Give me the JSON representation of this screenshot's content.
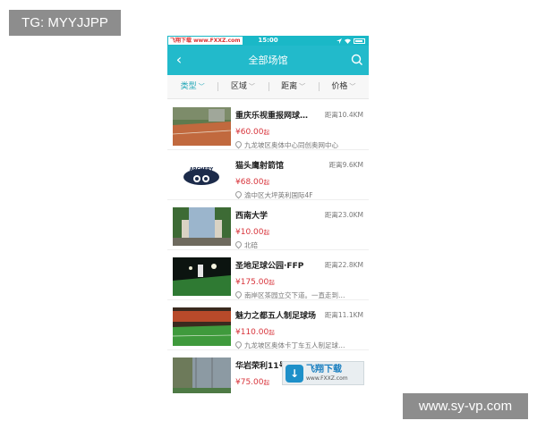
{
  "overlay": {
    "tg_label": "TG: MYYJJPP",
    "site_label": "www.sy-vp.com"
  },
  "status": {
    "source": "飞翔下载 www.FXXZ.com",
    "time": "15:00"
  },
  "nav": {
    "title": "全部场馆",
    "back_icon": "chevron-left-icon",
    "search_icon": "search-icon"
  },
  "filters": [
    {
      "label": "类型"
    },
    {
      "label": "区域"
    },
    {
      "label": "距离"
    },
    {
      "label": "价格"
    }
  ],
  "venues": [
    {
      "name": "重庆乐视重报网球…",
      "distance": "距离10.4KM",
      "price": "¥60.00",
      "price_suffix": "起",
      "address": "九龙坡区奥体中心同创奥网中心"
    },
    {
      "name": "猫头鹰射箭馆",
      "distance": "距离9.6KM",
      "price": "¥68.00",
      "price_suffix": "起",
      "address": "渝中区大坪英利国际4F"
    },
    {
      "name": "西南大学",
      "distance": "距离23.0KM",
      "price": "¥10.00",
      "price_suffix": "起",
      "address": "北碚"
    },
    {
      "name": "圣地足球公园·FFP",
      "distance": "距离22.8KM",
      "price": "¥175.00",
      "price_suffix": "起",
      "address": "南岸区茶园立交下道。一直走到…"
    },
    {
      "name": "魅力之都五人制足球场",
      "distance": "距离11.1KM",
      "price": "¥110.00",
      "price_suffix": "起",
      "address": "九龙坡区奥体卡丁车五人制足球…"
    },
    {
      "name": "华岩荣利11号",
      "distance": "",
      "price": "¥75.00",
      "price_suffix": "起",
      "address": ""
    }
  ],
  "thumb_logo_text": "ARCHERY",
  "watermark": {
    "text": "飞翔下载",
    "url": "www.FXXZ.com"
  }
}
